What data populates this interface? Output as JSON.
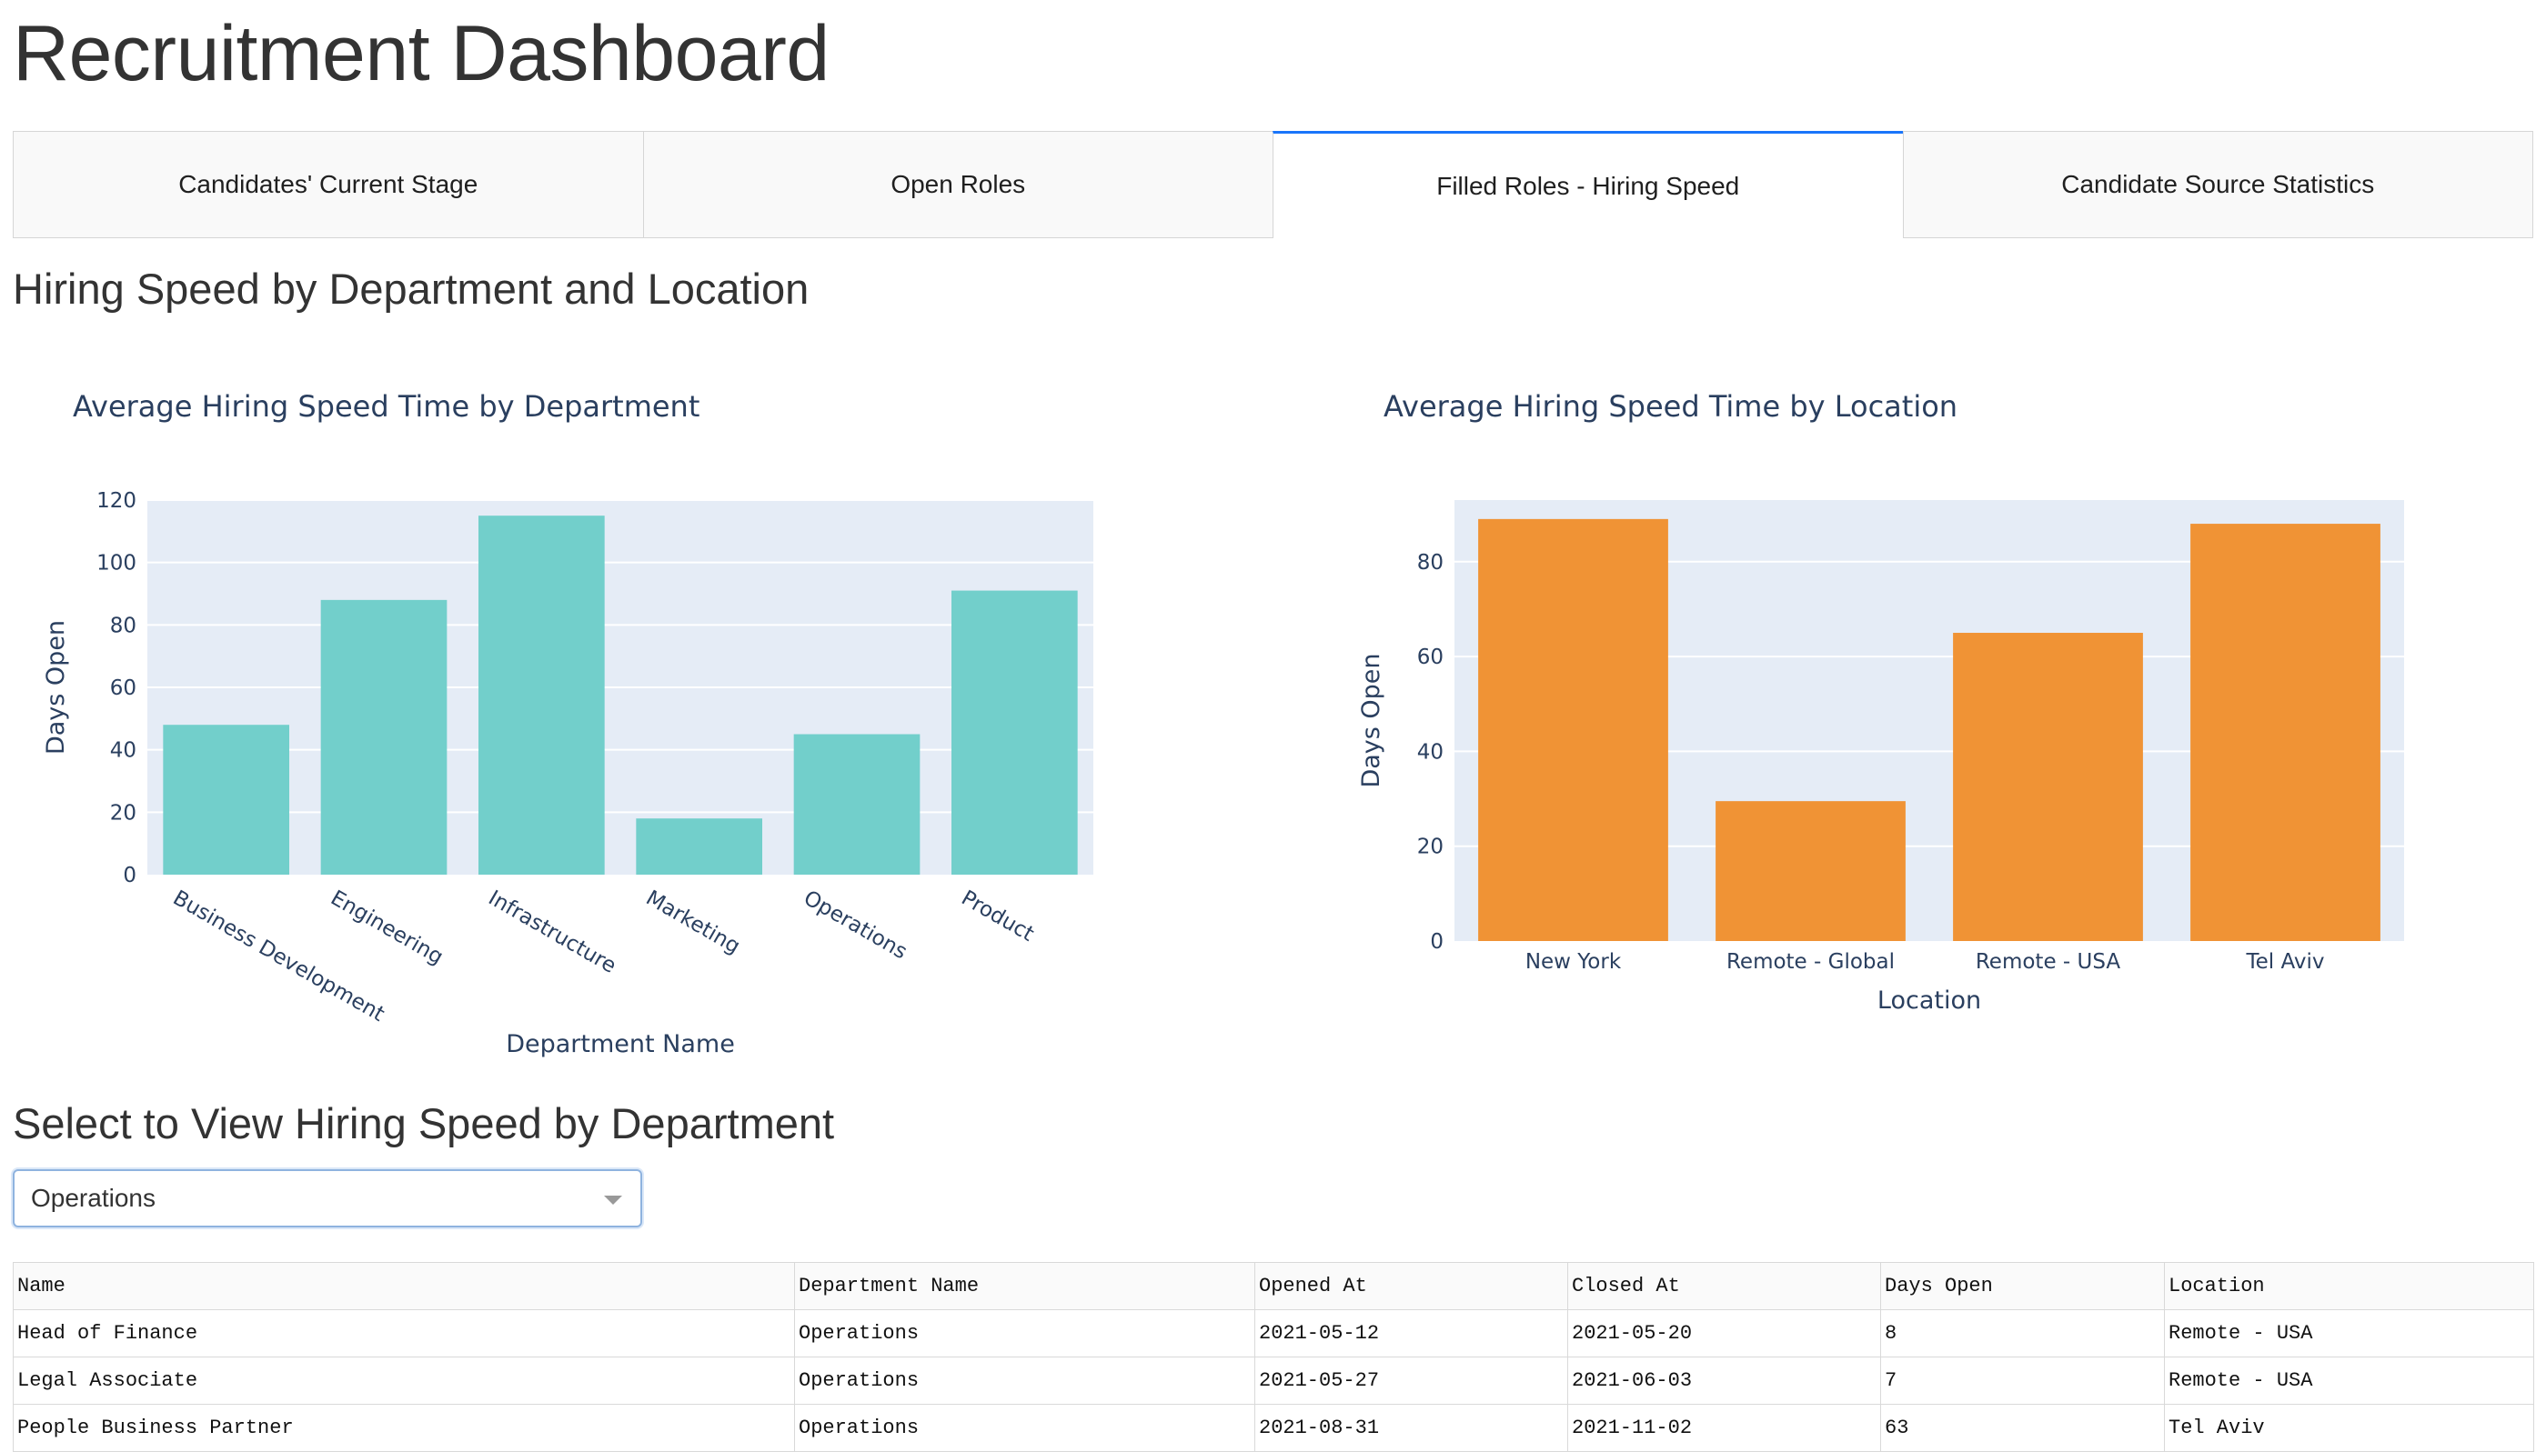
{
  "app": {
    "title": "Recruitment Dashboard"
  },
  "tabs": [
    {
      "label": "Candidates' Current Stage",
      "selected": false
    },
    {
      "label": "Open Roles",
      "selected": false
    },
    {
      "label": "Filled Roles - Hiring Speed",
      "selected": true
    },
    {
      "label": "Candidate Source Statistics",
      "selected": false
    }
  ],
  "section": {
    "title": "Hiring Speed by Department and Location",
    "select_title": "Select to View Hiring Speed by Department"
  },
  "colors": {
    "accent": "#1975fa",
    "department_bar": "#72cfcb",
    "location_bar": "#f09335",
    "plot_bg": "#e5ecf6",
    "axis_text": "#2a3f5f"
  },
  "chart_data": [
    {
      "type": "bar",
      "title": "Average Hiring Speed Time by Department",
      "xlabel": "Department Name",
      "ylabel": "Days Open",
      "categories": [
        "Business Development",
        "Engineering",
        "Infrastructure",
        "Marketing",
        "Operations",
        "Product"
      ],
      "values": [
        48,
        88,
        115,
        18,
        45,
        91
      ],
      "yticks": [
        0,
        20,
        40,
        60,
        80,
        100,
        120
      ],
      "ylim": [
        0,
        120
      ],
      "color": "#72cfcb",
      "grid": true
    },
    {
      "type": "bar",
      "title": "Average Hiring Speed Time by Location",
      "xlabel": "Location",
      "ylabel": "Days Open",
      "categories": [
        "New York",
        "Remote - Global",
        "Remote - USA",
        "Tel Aviv"
      ],
      "values": [
        89,
        29.5,
        65,
        88
      ],
      "yticks": [
        0,
        20,
        40,
        60,
        80
      ],
      "ylim": [
        0,
        93
      ],
      "color": "#f09335",
      "grid": true
    }
  ],
  "dropdown": {
    "value": "Operations"
  },
  "table": {
    "columns": [
      "Name",
      "Department Name",
      "Opened At",
      "Closed At",
      "Days Open",
      "Location"
    ],
    "rows": [
      [
        "Head of Finance",
        "Operations",
        "2021-05-12",
        "2021-05-20",
        "8",
        "Remote - USA"
      ],
      [
        "Legal Associate",
        "Operations",
        "2021-05-27",
        "2021-06-03",
        "7",
        "Remote - USA"
      ],
      [
        "People Business Partner",
        "Operations",
        "2021-08-31",
        "2021-11-02",
        "63",
        "Tel Aviv"
      ]
    ]
  }
}
